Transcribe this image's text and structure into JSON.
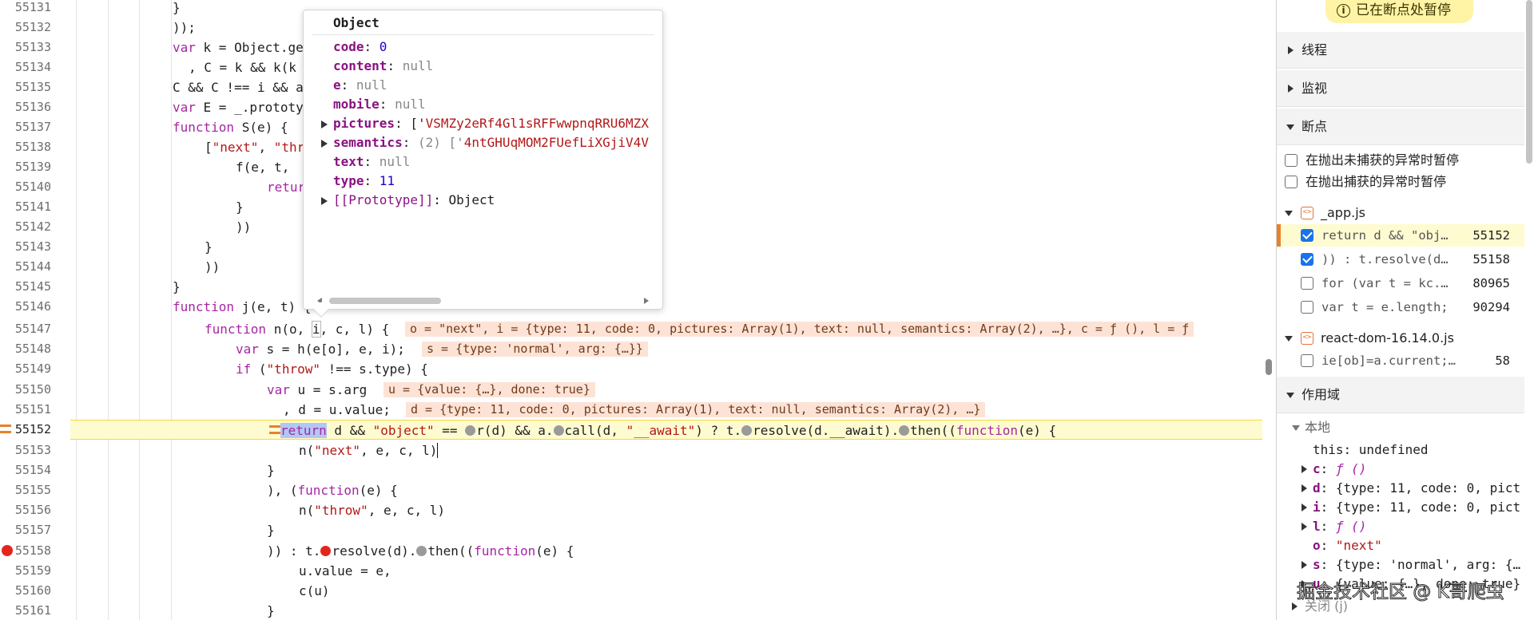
{
  "editor": {
    "lines": [
      {
        "n": "55131"
      },
      {
        "n": "55132"
      },
      {
        "n": "55133"
      },
      {
        "n": "55134"
      },
      {
        "n": "55135"
      },
      {
        "n": "55136"
      },
      {
        "n": "55137"
      },
      {
        "n": "55138"
      },
      {
        "n": "55139"
      },
      {
        "n": "55140"
      },
      {
        "n": "55141"
      },
      {
        "n": "55142"
      },
      {
        "n": "55143"
      },
      {
        "n": "55144"
      },
      {
        "n": "55145"
      },
      {
        "n": "55146"
      },
      {
        "n": "55147"
      },
      {
        "n": "55148"
      },
      {
        "n": "55149"
      },
      {
        "n": "55150"
      },
      {
        "n": "55151"
      },
      {
        "n": "55152"
      },
      {
        "n": "55153"
      },
      {
        "n": "55154"
      },
      {
        "n": "55155"
      },
      {
        "n": "55156"
      },
      {
        "n": "55157"
      },
      {
        "n": "55158"
      },
      {
        "n": "55159"
      },
      {
        "n": "55160"
      },
      {
        "n": "55161"
      }
    ],
    "code": {
      "l55131": "}",
      "l55132": "));",
      "l55133a": "var ",
      "l55133b": "k = Object.ge",
      "l55134": ", C = k && k(k",
      "l55135": "C && C !== i && a",
      "l55136a": "var ",
      "l55136b": "E = _.prototy",
      "l55137a": "function ",
      "l55137b": "S(e) {",
      "l55138a": "[",
      "l55138b": "\"next\"",
      "l55138c": ", ",
      "l55138d": "\"thr",
      "l55139": "f(e, t, ",
      "l55140": "retur",
      "l55141": "}",
      "l55142": "))",
      "l55143": "}",
      "l55144": "))",
      "l55145": "}",
      "l55146a": "function ",
      "l55146b": "j(e, t) {",
      "l55147a": "function ",
      "l55147b": "n(o, ",
      "l55147c": "i",
      "l55147d": ", c, l) {",
      "l55147v": "o = \"next\", i = {type: 11, code: 0, pictures: Array(1), text: null, semantics: Array(2), …}, c = ƒ (), l = ƒ",
      "l55148a": "var ",
      "l55148b": "s = h(e[o], e, i);",
      "l55148v": "s = {type: 'normal', arg: {…}}",
      "l55149a": "if ",
      "l55149b": "(",
      "l55149c": "\"throw\"",
      "l55149d": " !== s.type) {",
      "l55150a": "var ",
      "l55150b": "u = s.arg",
      "l55150v": "u = {value: {…}, done: true}",
      "l55151": ", d = u.value;",
      "l55151v": "d = {type: 11, code: 0, pictures: Array(1), text: null, semantics: Array(2), …}",
      "l55152a": "return",
      "l55152b": " d && ",
      "l55152c": "\"object\"",
      "l55152d": " == ",
      "l55152e": "r(d) && a.",
      "l55152f": "call(d, ",
      "l55152g": "\"__await\"",
      "l55152h": ") ? t.",
      "l55152i": "resolve(d.__await).",
      "l55152j": "then((",
      "l55152k": "function",
      "l55152l": "(e) {",
      "l55153a": "n(",
      "l55153b": "\"next\"",
      "l55153c": ", e, c, l)",
      "l55154": "}",
      "l55155a": "), (",
      "l55155b": "function",
      "l55155c": "(e) {",
      "l55156a": "n(",
      "l55156b": "\"throw\"",
      "l55156c": ", e, c, l)",
      "l55157": "}",
      "l55158a": ")) : t.",
      "l55158b": "resolve(d).",
      "l55158c": "then((",
      "l55158d": "function",
      "l55158e": "(e) {",
      "l55159": "u.value = e,",
      "l55160": "c(u)",
      "l55161": "}"
    }
  },
  "popover": {
    "title": "Object",
    "rows": [
      {
        "key": "code",
        "sep": ": ",
        "val": "0",
        "kind": "num"
      },
      {
        "key": "content",
        "sep": ": ",
        "val": "null",
        "kind": "null"
      },
      {
        "key": "e",
        "sep": ": ",
        "val": "null",
        "kind": "null"
      },
      {
        "key": "mobile",
        "sep": ": ",
        "val": "null",
        "kind": "null"
      },
      {
        "key": "pictures",
        "sep": ": ",
        "pre": "['",
        "val": "VSMZy2eRf4Gl1sRFFwwpnqRRU6MZX",
        "kind": "str"
      },
      {
        "key": "semantics",
        "sep": ": ",
        "pre": "(2) ['",
        "val": "4ntGHUqMOM2FUefLiXGjiV4V",
        "kind": "str"
      },
      {
        "key": "text",
        "sep": ": ",
        "val": "null",
        "kind": "null"
      },
      {
        "key": "type",
        "sep": ": ",
        "val": "11",
        "kind": "num"
      },
      {
        "key": "[[Prototype]]",
        "sep": ": ",
        "val": "Object",
        "kind": "plain"
      }
    ]
  },
  "sidebar": {
    "paused_banner": "已在断点处暂停",
    "sections": {
      "threads": "线程",
      "watch": "监视",
      "breakpoints": "断点",
      "scope": "作用域"
    },
    "exception_options": {
      "uncaught": "在抛出未捕获的异常时暂停",
      "caught": "在抛出捕获的异常时暂停"
    },
    "files": {
      "app": "_app.js",
      "react": "react-dom-16.14.0.js"
    },
    "breakpoints": [
      {
        "code": "return d && \"obj…",
        "line": "55152",
        "checked": true
      },
      {
        "code": ")) : t.resolve(d…",
        "line": "55158",
        "checked": true
      },
      {
        "code": "for (var t = kc.…",
        "line": "80965",
        "checked": false
      },
      {
        "code": "var t = e.length;",
        "line": "90294",
        "checked": false
      },
      {
        "code": "ie[ob]=a.current;a…",
        "line": "58",
        "checked": false
      }
    ],
    "scope": {
      "local": "本地",
      "this_key": "this",
      "this_val": "undefined",
      "vars": [
        {
          "key": "c",
          "val": "ƒ ()",
          "kind": "fn"
        },
        {
          "key": "d",
          "val": "{type: 11, code: 0, pict",
          "kind": "obj"
        },
        {
          "key": "i",
          "val": "{type: 11, code: 0, pict",
          "kind": "obj"
        },
        {
          "key": "l",
          "val": "ƒ ()",
          "kind": "fn"
        },
        {
          "key": "o",
          "val": "\"next\"",
          "kind": "str"
        },
        {
          "key": "s",
          "val": "{type: 'normal', arg: {…",
          "kind": "obj"
        },
        {
          "key": "u",
          "val": "{value: {…}, done: true}",
          "kind": "obj"
        }
      ],
      "closure": "关闭 (j)"
    },
    "watermark": "掘金技术社区 @ K哥爬虫"
  }
}
